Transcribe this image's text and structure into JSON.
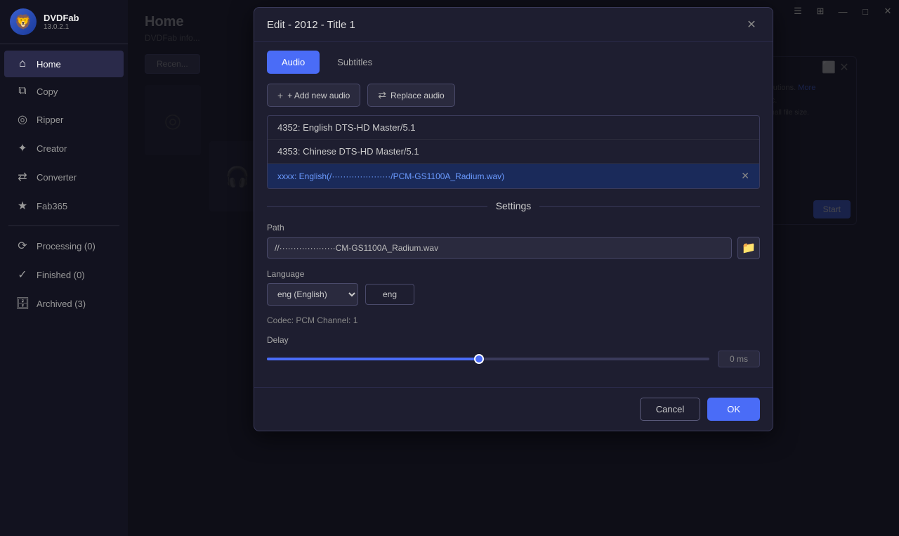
{
  "app": {
    "name": "DVDFab",
    "version": "13.0.2.1",
    "logo_emoji": "🦁"
  },
  "title_bar": {
    "minimize": "—",
    "maximize": "□",
    "close": "✕",
    "settings_icon": "☰",
    "widget_icon": "⊞"
  },
  "sidebar": {
    "items": [
      {
        "id": "home",
        "label": "Home",
        "icon": "⌂",
        "active": true
      },
      {
        "id": "copy",
        "label": "Copy",
        "icon": "⧉",
        "active": false
      },
      {
        "id": "ripper",
        "label": "Ripper",
        "icon": "◎",
        "active": false
      },
      {
        "id": "creator",
        "label": "Creator",
        "icon": "✦",
        "active": false
      },
      {
        "id": "converter",
        "label": "Converter",
        "icon": "⇄",
        "active": false
      },
      {
        "id": "fab365",
        "label": "Fab365",
        "icon": "★",
        "active": false
      }
    ],
    "bottom_items": [
      {
        "id": "processing",
        "label": "Processing (0)",
        "icon": "⟳"
      },
      {
        "id": "finished",
        "label": "Finished (0)",
        "icon": "✓"
      },
      {
        "id": "archived",
        "label": "Archived (3)",
        "icon": "🗄"
      }
    ]
  },
  "home": {
    "title": "Home",
    "subtitle": "DVDFab info..."
  },
  "modal": {
    "title": "Edit - 2012 - Title 1",
    "tabs": [
      {
        "id": "audio",
        "label": "Audio",
        "active": true
      },
      {
        "id": "subtitles",
        "label": "Subtitles",
        "active": false
      }
    ],
    "add_audio_label": "+ Add new audio",
    "replace_audio_label": "⇄ Replace audio",
    "tracks": [
      {
        "id": "t1",
        "label": "4352: English DTS-HD Master/5.1",
        "selected": false,
        "removable": false
      },
      {
        "id": "t2",
        "label": "4353: Chinese DTS-HD Master/5.1",
        "selected": false,
        "removable": false
      },
      {
        "id": "t3",
        "label": "xxxx: English(/......../PCM-GS1100A_Radium.wav)",
        "selected": true,
        "removable": true,
        "path_display": "xxxx: English(/········/PCM-GS1100A_Radium.wav)"
      }
    ],
    "settings_label": "Settings",
    "path_label": "Path",
    "path_value": "//····················CM-GS1100A_Radium.wav",
    "language_label": "Language",
    "language_select_value": "eng (English)",
    "language_code_value": "eng",
    "codec_info": "Codec: PCM   Channel: 1",
    "delay_label": "Delay",
    "delay_value": "0 ms",
    "slider_percent": 48,
    "cancel_label": "Cancel",
    "ok_label": "OK",
    "close_icon": "✕"
  },
  "background": {
    "start_label": "Start"
  }
}
